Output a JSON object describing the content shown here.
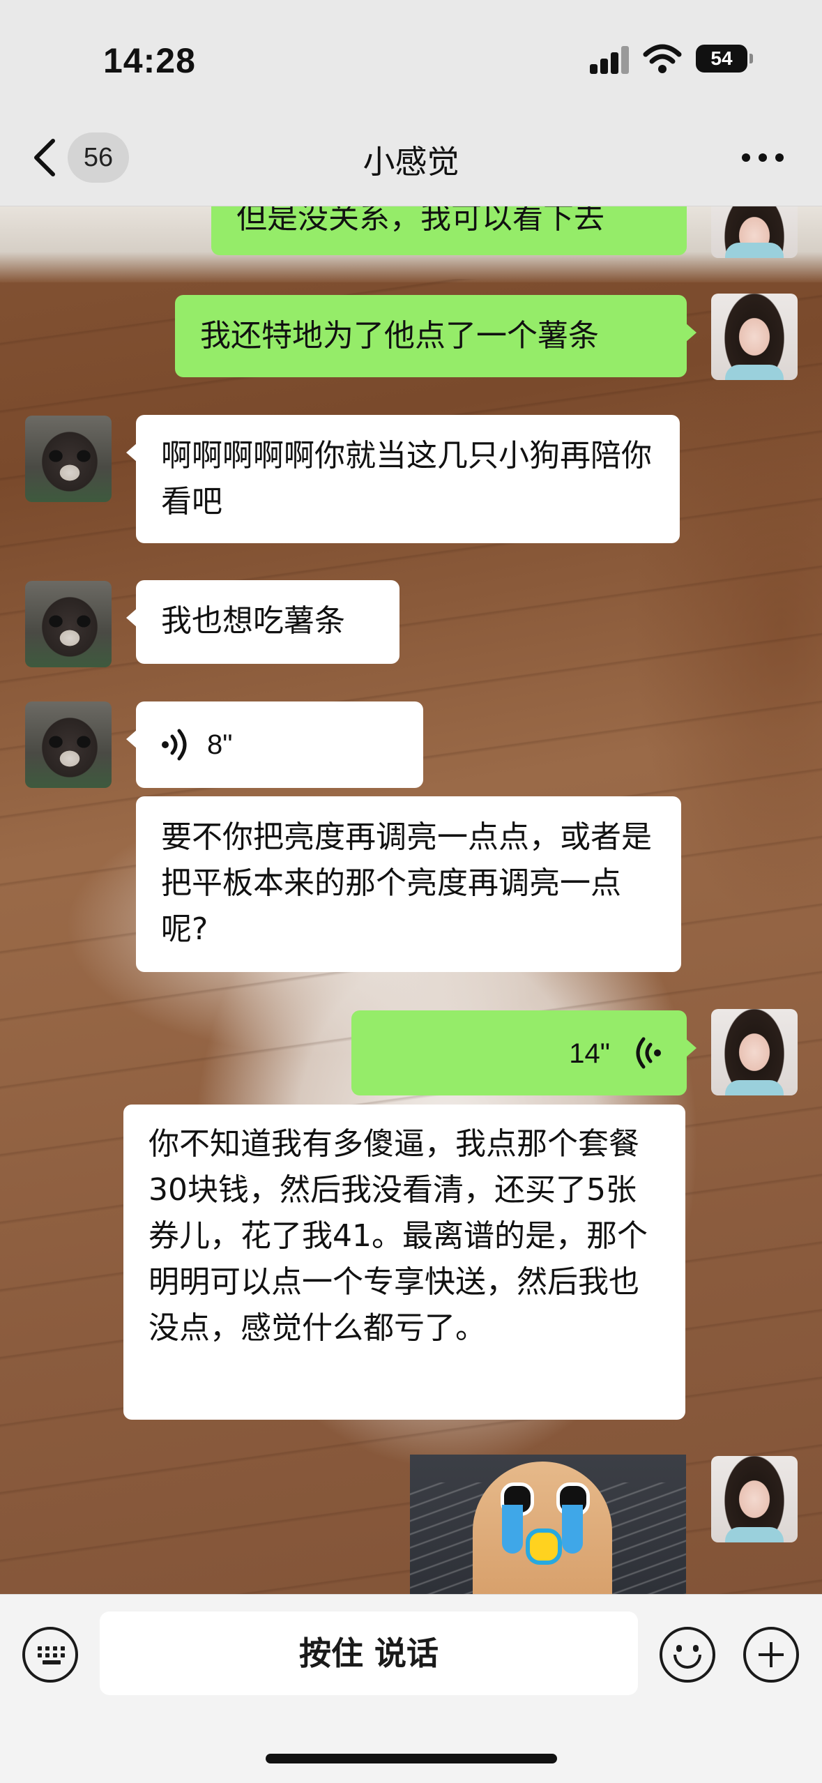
{
  "status_bar": {
    "time": "14:28",
    "battery": "54"
  },
  "nav": {
    "back_count": "56",
    "title": "小感觉"
  },
  "messages": [
    {
      "sender": "me",
      "type": "text",
      "text": "但是没关系，我可以看下去"
    },
    {
      "sender": "me",
      "type": "text",
      "text": "我还特地为了他点了一个薯条"
    },
    {
      "sender": "other",
      "type": "text",
      "text": "啊啊啊啊啊你就当这几只小狗再陪你看吧"
    },
    {
      "sender": "other",
      "type": "text",
      "text": "我也想吃薯条"
    },
    {
      "sender": "other",
      "type": "voice",
      "duration": "8\""
    },
    {
      "sender": "other",
      "type": "text",
      "text": "要不你把亮度再调亮一点点，或者是把平板本来的那个亮度再调亮一点呢?"
    },
    {
      "sender": "me",
      "type": "voice",
      "duration": "14\""
    },
    {
      "sender": "me",
      "type": "text",
      "text": "你不知道我有多傻逼，我点那个套餐30块钱，然后我没看清，还买了5张券儿，花了我41。最离谱的是，那个明明可以点一个专享快送，然后我也没点，感觉什么都亏了。"
    },
    {
      "sender": "me",
      "type": "sticker",
      "sticker": "crying-dog-sticker"
    }
  ],
  "input_bar": {
    "hold_to_talk": "按住 说话"
  },
  "colors": {
    "outgoing_bubble": "#95ec69",
    "incoming_bubble": "#ffffff",
    "top_bar": "#e9e9e9"
  },
  "icons": [
    "keyboard-icon",
    "emoji-icon",
    "plus-icon",
    "back-chevron-icon",
    "more-icon",
    "voice-wave-icon"
  ]
}
